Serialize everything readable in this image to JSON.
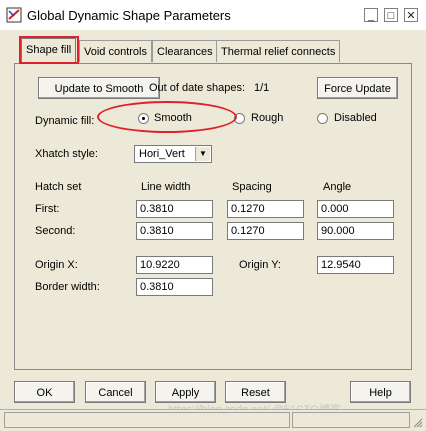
{
  "window": {
    "title": "Global Dynamic Shape Parameters",
    "min": "_",
    "max": "□",
    "close": "✕"
  },
  "tabs": [
    {
      "label": "Shape fill"
    },
    {
      "label": "Void controls"
    },
    {
      "label": "Clearances"
    },
    {
      "label": "Thermal relief connects"
    }
  ],
  "shape_fill": {
    "update_to_smooth": "Update to Smooth",
    "out_of_date_label": "Out of date shapes:",
    "out_of_date_value": "1/1",
    "force_update": "Force Update",
    "dynamic_fill_label": "Dynamic fill:",
    "fill_options": [
      "Smooth",
      "Rough",
      "Disabled"
    ],
    "selected_fill": "Smooth",
    "xhatch_label": "Xhatch style:",
    "xhatch_value": "Hori_Vert",
    "hatch_set_label": "Hatch set",
    "col_line_width": "Line width",
    "col_spacing": "Spacing",
    "col_angle": "Angle",
    "first_label": "First:",
    "first": {
      "line_width": "0.3810",
      "spacing": "0.1270",
      "angle": "0.000"
    },
    "second_label": "Second:",
    "second": {
      "line_width": "0.3810",
      "spacing": "0.1270",
      "angle": "90.000"
    },
    "origin_x_label": "Origin X:",
    "origin_x": "10.9220",
    "origin_y_label": "Origin Y:",
    "origin_y": "12.9540",
    "border_width_label": "Border width:",
    "border_width": "0.3810"
  },
  "footer": {
    "ok": "OK",
    "cancel": "Cancel",
    "apply": "Apply",
    "reset": "Reset",
    "help": "Help"
  },
  "watermark": "https://blog.csdn.net/ @51CTO博客",
  "colors": {
    "highlight": "#e0202a",
    "dialog_bg": "#ece9d8"
  }
}
